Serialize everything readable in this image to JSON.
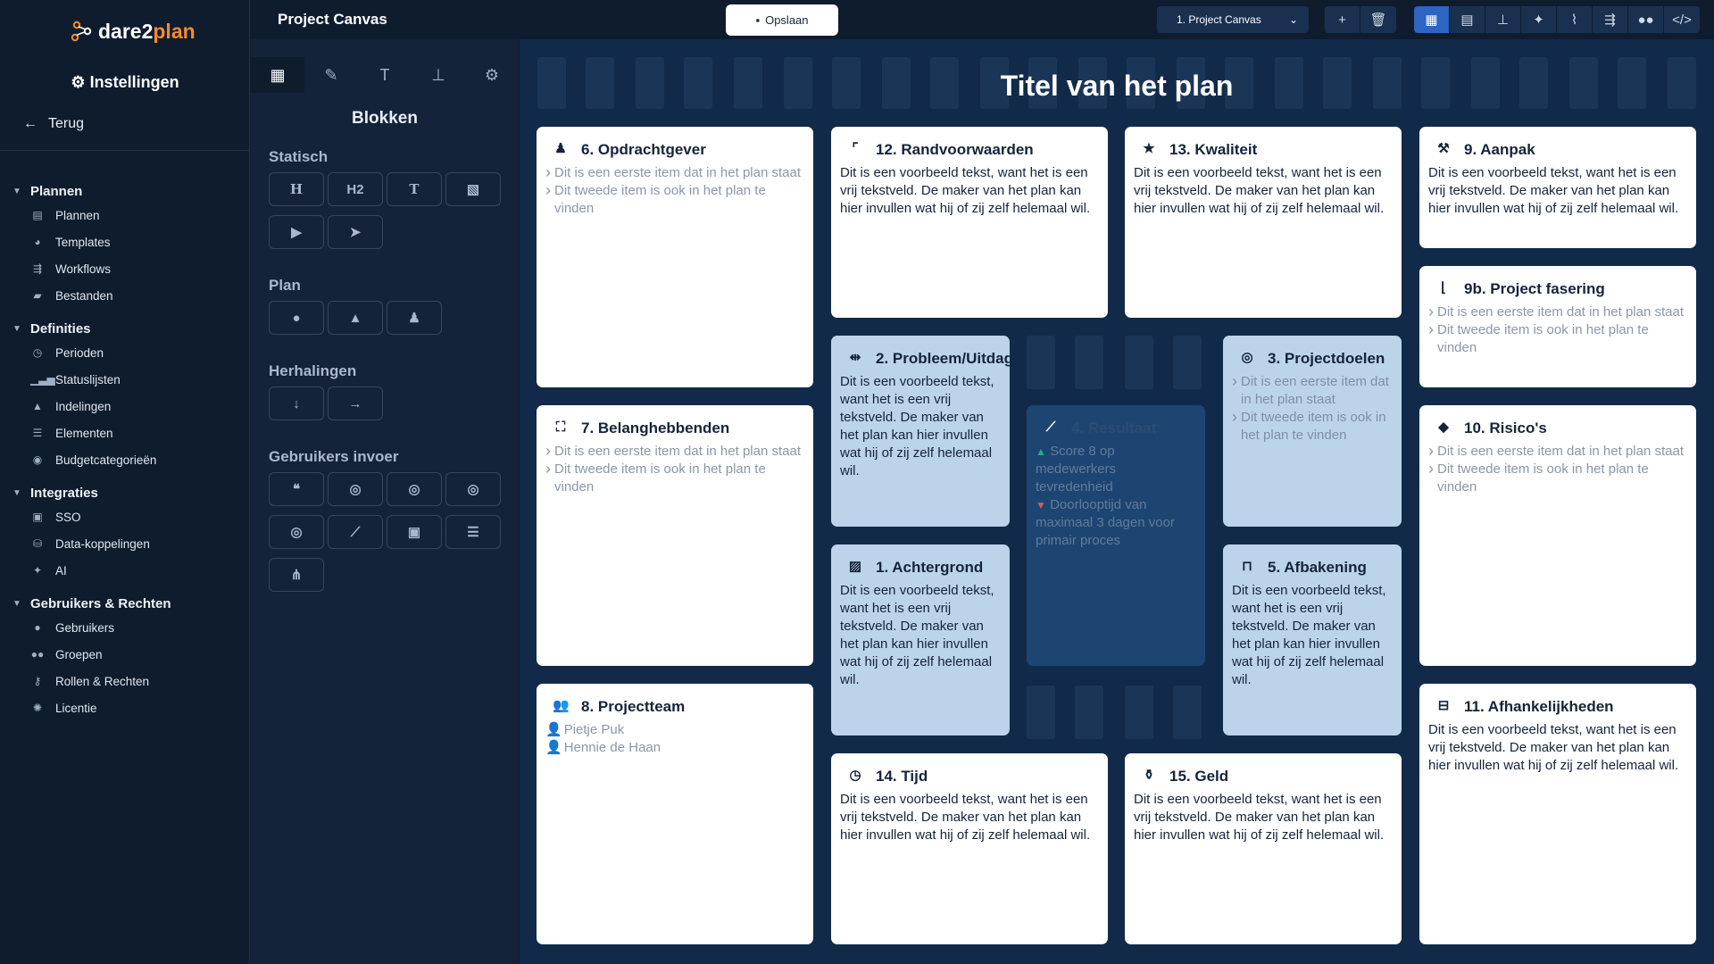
{
  "app": {
    "logo_part1": "dare2",
    "logo_part2": "plan",
    "brand_color": "#f28c28"
  },
  "sidebar": {
    "title": "Instellingen",
    "back": "Terug",
    "sections": [
      {
        "label": "Plannen",
        "items": [
          {
            "label": "Plannen",
            "icon": "copy-icon"
          },
          {
            "label": "Templates",
            "icon": "palette-icon"
          },
          {
            "label": "Workflows",
            "icon": "workflow-icon"
          },
          {
            "label": "Bestanden",
            "icon": "folder-icon"
          }
        ]
      },
      {
        "label": "Definities",
        "items": [
          {
            "label": "Perioden",
            "icon": "clock-icon"
          },
          {
            "label": "Statuslijsten",
            "icon": "signal-icon"
          },
          {
            "label": "Indelingen",
            "icon": "shapes-icon"
          },
          {
            "label": "Elementen",
            "icon": "sliders-icon"
          },
          {
            "label": "Budgetcategorieën",
            "icon": "coins-icon"
          }
        ]
      },
      {
        "label": "Integraties",
        "items": [
          {
            "label": "SSO",
            "icon": "id-card-icon"
          },
          {
            "label": "Data-koppelingen",
            "icon": "database-icon"
          },
          {
            "label": "AI",
            "icon": "sparkles-icon"
          }
        ]
      },
      {
        "label": "Gebruikers & Rechten",
        "items": [
          {
            "label": "Gebruikers",
            "icon": "user-icon"
          },
          {
            "label": "Groepen",
            "icon": "users-icon"
          },
          {
            "label": "Rollen & Rechten",
            "icon": "key-icon"
          },
          {
            "label": "Licentie",
            "icon": "certificate-icon"
          }
        ]
      }
    ]
  },
  "panel": {
    "project_title": "Project Canvas",
    "blocks_title": "Blokken",
    "groups": {
      "statisch": "Statisch",
      "plan": "Plan",
      "herhalingen": "Herhalingen",
      "gebruikers_invoer": "Gebruikers invoer"
    },
    "statisch_buttons": [
      "H",
      "H2",
      "T"
    ]
  },
  "topbar": {
    "save_label": "Opslaan",
    "plan_select": "1. Project Canvas"
  },
  "canvas": {
    "title": "Titel van het plan",
    "cards": {
      "opdrachtgever": {
        "title": "6. Opdrachtgever",
        "items": [
          "Dit is een eerste item dat in het plan staat",
          "Dit tweede item is ook in het plan te vinden"
        ]
      },
      "randvoorwaarden": {
        "title": "12. Randvoorwaarden",
        "text": "Dit is een voorbeeld tekst, want het is een vrij tekstveld. De maker van het plan kan hier invullen wat hij of zij zelf helemaal wil."
      },
      "kwaliteit": {
        "title": "13. Kwaliteit",
        "text": "Dit is een voorbeeld tekst, want het is een vrij tekstveld. De maker van het plan kan hier invullen wat hij of zij zelf helemaal wil."
      },
      "aanpak": {
        "title": "9. Aanpak",
        "text": "Dit is een voorbeeld tekst, want het is een vrij tekstveld. De maker van het plan kan hier invullen wat hij of zij zelf helemaal wil."
      },
      "fasering": {
        "title": "9b. Project fasering",
        "items": [
          "Dit is een eerste item dat in het plan staat",
          "Dit tweede item is ook in het plan te vinden"
        ]
      },
      "probleem": {
        "title": "2. Probleem/Uitdaging",
        "text": "Dit is een voorbeeld tekst, want het is een vrij tekstveld. De maker van het plan kan hier invullen wat hij of zij zelf helemaal wil."
      },
      "doelen": {
        "title": "3. Projectdoelen",
        "items": [
          "Dit is een eerste item dat in het plan staat",
          "Dit tweede item is ook in het plan te vinden"
        ]
      },
      "resultaat": {
        "title": "4. Resultaat",
        "up": "Score 8 op medewerkers tevredenheid",
        "down": "Doorlooptijd van maximaal 3 dagen voor primair proces"
      },
      "belanghebbenden": {
        "title": "7. Belanghebbenden",
        "items": [
          "Dit is een eerste item dat in het plan staat",
          "Dit tweede item is ook in het plan te vinden"
        ]
      },
      "risicos": {
        "title": "10. Risico's",
        "items": [
          "Dit is een eerste item dat in het plan staat",
          "Dit tweede item is ook in het plan te vinden"
        ]
      },
      "achtergrond": {
        "title": "1. Achtergrond",
        "text": "Dit is een voorbeeld tekst, want het is een vrij tekstveld. De maker van het plan kan hier invullen wat hij of zij zelf helemaal wil."
      },
      "afbakening": {
        "title": "5. Afbakening",
        "text": "Dit is een voorbeeld tekst, want het is een vrij tekstveld. De maker van het plan kan hier invullen wat hij of zij zelf helemaal wil."
      },
      "projectteam": {
        "title": "8. Projectteam",
        "people": [
          "Pietje Puk",
          "Hennie de Haan"
        ]
      },
      "afhankelijkheden": {
        "title": "11. Afhankelijkheden",
        "text": "Dit is een voorbeeld tekst, want het is een vrij tekstveld. De maker van het plan kan hier invullen wat hij of zij zelf helemaal wil."
      },
      "tijd": {
        "title": "14. Tijd",
        "text": "Dit is een voorbeeld tekst, want het is een vrij tekstveld. De maker van het plan kan hier invullen wat hij of zij zelf helemaal wil."
      },
      "geld": {
        "title": "15. Geld",
        "text": "Dit is een voorbeeld tekst, want het is een vrij tekstveld. De maker van het plan kan hier invullen wat hij of zij zelf helemaal wil."
      }
    }
  }
}
